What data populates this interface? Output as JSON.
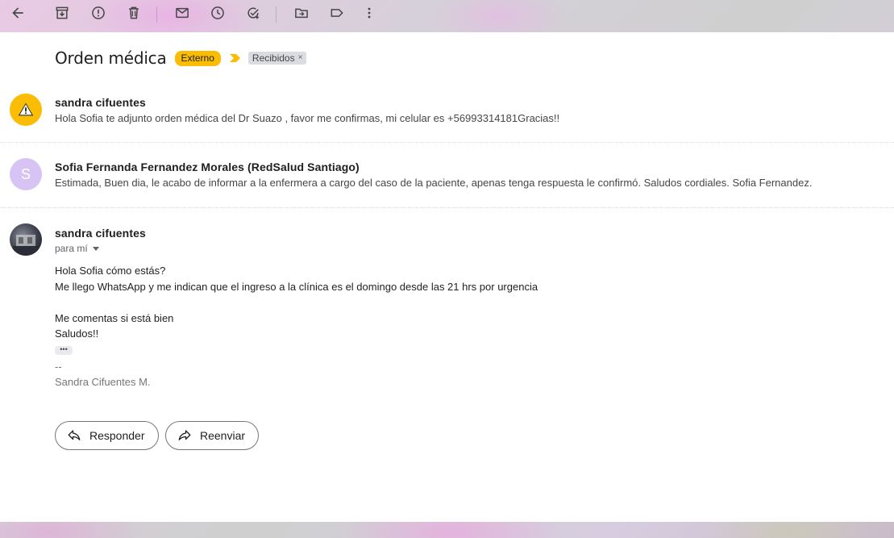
{
  "toolbar": {
    "buttons": [
      "back-icon",
      "archive-icon",
      "report-spam-icon",
      "delete-icon",
      "mark-unread-icon",
      "snooze-icon",
      "add-task-icon",
      "move-to-icon",
      "label-icon",
      "more-icon"
    ]
  },
  "thread": {
    "subject": "Orden médica",
    "external_chip": "Externo",
    "label_chip": "Recibidos",
    "label_remove": "×"
  },
  "messages": [
    {
      "sender": "sandra cifuentes",
      "snippet": "Hola Sofia te adjunto orden médica del Dr Suazo , favor me confirmas, mi celular es +56993314181Gracias!!",
      "avatar": "warning-icon",
      "avatar_color": "#fbbc04"
    },
    {
      "sender": "Sofia Fernanda Fernandez Morales (RedSalud Santiago)",
      "snippet": "Estimada, Buen dia, le acabo de informar a la enfermera a cargo del caso de la paciente, apenas tenga respuesta le confirmó. Saludos cordiales. Sofia Fernandez.",
      "avatar_letter": "S",
      "avatar_color": "#d7c4f5"
    },
    {
      "sender": "sandra cifuentes",
      "to": "para mí",
      "body": [
        "Hola Sofia cómo estás?",
        "Me llego WhatsApp y me indican que el ingreso a la clínica es el domingo desde las 21 hrs por urgencia",
        "Me comentas si está bien",
        "Saludos!!"
      ],
      "trimmed": "•••",
      "signature_sep": "--",
      "signature": "Sandra Cifuentes M."
    }
  ],
  "actions": {
    "reply": "Responder",
    "forward": "Reenviar"
  },
  "colors": {
    "external_chip": "#fbbc04",
    "label_chip": "#dadce0",
    "panel": "#ffffff"
  }
}
